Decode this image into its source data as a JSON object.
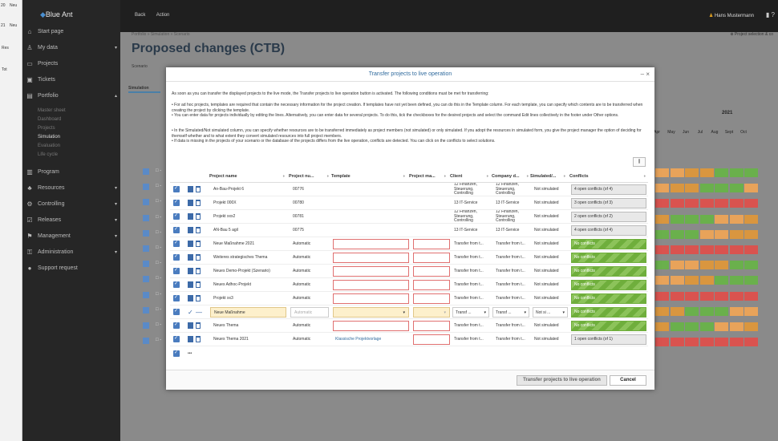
{
  "left_strip": [
    "20",
    "Neu",
    "21",
    "Neu",
    "Res",
    "Tot"
  ],
  "app": {
    "logo": "Blue Ant"
  },
  "topbar": {
    "back": "Back",
    "action": "Action",
    "user": "Hans Mustermann",
    "icons": [
      "user-icon",
      "bookmark-icon",
      "help-icon"
    ]
  },
  "sidebar": {
    "items": [
      {
        "icon": "⌂",
        "label": "Start page",
        "chev": ""
      },
      {
        "icon": "♙",
        "label": "My data",
        "chev": "▾"
      },
      {
        "icon": "▭",
        "label": "Projects",
        "chev": ""
      },
      {
        "icon": "▣",
        "label": "Tickets",
        "chev": ""
      },
      {
        "icon": "▤",
        "label": "Portfolio",
        "chev": "▴"
      }
    ],
    "portfolio_sub": [
      "Master sheet",
      "Dashboard",
      "Projects",
      "Simulation",
      "Evaluation",
      "Life cycle"
    ],
    "items2": [
      {
        "icon": "▥",
        "label": "Program",
        "chev": ""
      },
      {
        "icon": "♣",
        "label": "Resources",
        "chev": "▾"
      },
      {
        "icon": "⚙",
        "label": "Controlling",
        "chev": "▾"
      },
      {
        "icon": "☑",
        "label": "Releases",
        "chev": "▾"
      },
      {
        "icon": "⚑",
        "label": "Management",
        "chev": "▾"
      },
      {
        "icon": "⚿",
        "label": "Administration",
        "chev": "▾"
      },
      {
        "icon": "●",
        "label": "Support request",
        "chev": ""
      }
    ]
  },
  "page": {
    "breadcrumb": "Portfolio  »  Simulation  »  Scenario",
    "title": "Proposed changes (CTB)",
    "project_selection": "⊕ Project selection & co",
    "scenario_label": "Scenario",
    "tab": "Simulation"
  },
  "background": {
    "year": "2021",
    "months": [
      "Apr",
      "May",
      "Jun",
      "Jul",
      "Aug",
      "Sept",
      "Oct"
    ],
    "row_ids": [
      "□ -",
      "□ -",
      "□ -",
      "□ -",
      "□ -",
      "□ -",
      "□ -",
      "□ -",
      "□ -",
      "□ -",
      "□ -",
      "□ -"
    ]
  },
  "dialog": {
    "title": "Transfer projects to live operation",
    "close": "– ×",
    "intro": "As soon as you can transfer the displayed projects to the live mode, the Transfer projects to live operation button is activated. The following conditions must be met for transferring:",
    "bullets": [
      "• For ad hoc projects, templates are required that contain the necessary information for the project creation. If templates have not yet been defined, you can do this in the Template column. For each template, you can specify which contents are to be transferred when creating the project by clicking the template.",
      "• You can enter data for projects individually by editing the lines. Alternatively, you can enter data for several projects. To do this, tick the checkboxes for the desired projects and select the command Edit lines collectively in the footer under Other options.",
      "• In the Simulated/Not simulated column, you can specify whether resources are to be transferred immediately as project members (not simulated) or only simulated. If you adopt the resources in simulated form, you give the project manager the option of deciding for themself whether and to what extent they convert simulated resources into full project members.",
      "• If data is missing in the projects of your scenario or the database of the projects differs from the live operation, conflicts are detected. You can click on the conflicts to select solutions."
    ],
    "columns": [
      "Project name",
      "Project nu...",
      "Template",
      "Project ma...",
      "Client",
      "Company d...",
      "Simulated/...",
      "Conflicts"
    ],
    "rows": [
      {
        "name": "An-Bau-Projekt 6",
        "num": "00776",
        "tpl": "",
        "client": "12 Finanzen, Steuerung, Controlling",
        "company": "12 Finanzen, Steuerung, Controlling",
        "sim": "Not simulated",
        "conf": "4 open conflicts (of 4)",
        "ok": false,
        "multi": true,
        "tplinp": false
      },
      {
        "name": "Projekt 000X",
        "num": "00780",
        "tpl": "",
        "client": "13 IT-Service",
        "company": "13 IT-Service",
        "sim": "Not simulated",
        "conf": "3 open conflicts (of 3)",
        "ok": false,
        "multi": false,
        "tplinp": false
      },
      {
        "name": "Projekt xxx2",
        "num": "00781",
        "tpl": "",
        "client": "12 Finanzen, Steuerung, Controlling",
        "company": "12 Finanzen, Steuerung, Controlling",
        "sim": "Not simulated",
        "conf": "2 open conflicts (of 2)",
        "ok": false,
        "multi": true,
        "tplinp": false
      },
      {
        "name": "AN-Bau 5 agil",
        "num": "00775",
        "tpl": "",
        "client": "13 IT-Service",
        "company": "13 IT-Service",
        "sim": "Not simulated",
        "conf": "4 open conflicts (of 4)",
        "ok": false,
        "multi": false,
        "tplinp": false
      },
      {
        "name": "Neue Maßnahme 2021",
        "num": "Automatic",
        "tpl": "",
        "client": "Transfer from t...",
        "company": "Transfer from t...",
        "sim": "Not simulated",
        "conf": "No conflicts",
        "ok": true,
        "multi": false,
        "tplinp": true
      },
      {
        "name": "Weiteres strategisches Thema",
        "num": "Automatic",
        "tpl": "",
        "client": "Transfer from t...",
        "company": "Transfer from t...",
        "sim": "Not simulated",
        "conf": "No conflicts",
        "ok": true,
        "multi": false,
        "tplinp": true
      },
      {
        "name": "Neues Demo-Projekt (Szenario)",
        "num": "Automatic",
        "tpl": "",
        "client": "Transfer from t...",
        "company": "Transfer from t...",
        "sim": "Not simulated",
        "conf": "No conflicts",
        "ok": true,
        "multi": false,
        "tplinp": true
      },
      {
        "name": "Neues Adhoc-Projekt",
        "num": "Automatic",
        "tpl": "",
        "client": "Transfer from t...",
        "company": "Transfer from t...",
        "sim": "Not simulated",
        "conf": "No conflicts",
        "ok": true,
        "multi": false,
        "tplinp": true
      },
      {
        "name": "Projekt xx3",
        "num": "Automatic",
        "tpl": "",
        "client": "Transfer from t...",
        "company": "Transfer from t...",
        "sim": "Not simulated",
        "conf": "No conflicts",
        "ok": true,
        "multi": false,
        "tplinp": true
      },
      {
        "name": "Neue Maßnahme",
        "num": "Automatic",
        "tpl": "",
        "client": "Transf ...",
        "company": "Transf ...",
        "sim": "Not si ...",
        "conf": "No conflicts",
        "ok": true,
        "multi": false,
        "tplinp": true,
        "editing": true
      },
      {
        "name": "Neues Thema",
        "num": "Automatic",
        "tpl": "",
        "client": "Transfer from t...",
        "company": "Transfer from t...",
        "sim": "Not simulated",
        "conf": "No conflicts",
        "ok": true,
        "multi": false,
        "tplinp": true
      },
      {
        "name": "Neues Thema 2021",
        "num": "Automatic",
        "tpl": "Klassische Projektvorlage",
        "client": "Transfer from t...",
        "company": "Transfer from t...",
        "sim": "Not simulated",
        "conf": "1 open conflicts (of 1)",
        "ok": false,
        "multi": false,
        "tplinp": false
      }
    ],
    "more": "•••",
    "btn_transfer": "Transfer projects to live operation",
    "btn_cancel": "Cancel"
  }
}
